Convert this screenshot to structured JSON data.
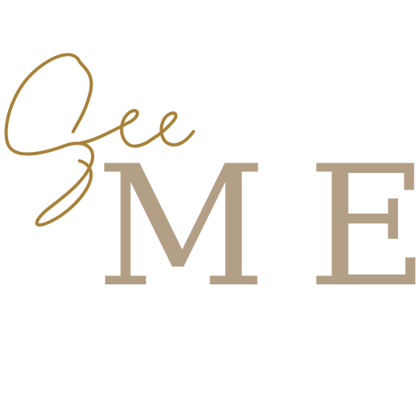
{
  "logo": {
    "script_word": "See",
    "serif_letters": [
      "M",
      "E"
    ],
    "colors": {
      "script_gold": "#A8823A",
      "serif_taupe": "#B39F86",
      "background": "#FFFFFF"
    }
  }
}
